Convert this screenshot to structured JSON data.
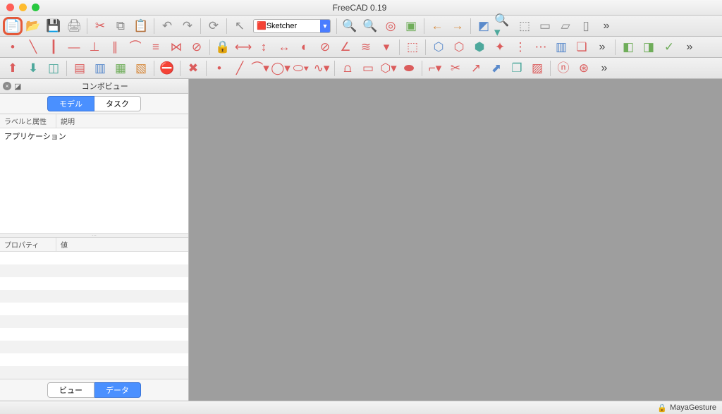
{
  "title": "FreeCAD 0.19",
  "workbench_selector": "Sketcher",
  "combo": {
    "panel_title": "コンボビュー",
    "tab_model": "モデル",
    "tab_task": "タスク",
    "col_label": "ラベルと属性",
    "col_desc": "説明",
    "tree_root": "アプリケーション",
    "prop_col1": "プロパティ",
    "prop_col2": "値",
    "bottom_view": "ビュー",
    "bottom_data": "データ"
  },
  "status": {
    "nav_style": "MayaGesture"
  },
  "toolbar1": [
    {
      "n": "new-file-icon",
      "g": "📄"
    },
    {
      "n": "open-file-icon",
      "g": "📂"
    },
    {
      "n": "save-icon",
      "g": "💾"
    },
    {
      "n": "print-icon",
      "g": "🖨"
    },
    {
      "n": "sep"
    },
    {
      "n": "cut-icon",
      "g": "✂",
      "c": "red"
    },
    {
      "n": "copy-icon",
      "g": "⧉"
    },
    {
      "n": "paste-icon",
      "g": "📋"
    },
    {
      "n": "sep"
    },
    {
      "n": "undo-icon",
      "g": "↶"
    },
    {
      "n": "redo-icon",
      "g": "↷"
    },
    {
      "n": "sep"
    },
    {
      "n": "refresh-icon",
      "g": "⟳"
    },
    {
      "n": "sep"
    },
    {
      "n": "pointer-icon",
      "g": "↖"
    },
    {
      "n": "workbench-select"
    },
    {
      "n": "sep"
    },
    {
      "n": "zoom-fit-icon",
      "g": "🔍",
      "c": "teal"
    },
    {
      "n": "zoom-select-icon",
      "g": "🔍"
    },
    {
      "n": "draw-style-icon",
      "g": "◎",
      "c": "red"
    },
    {
      "n": "bbox-icon",
      "g": "▣",
      "c": "green"
    },
    {
      "n": "sep"
    },
    {
      "n": "nav-back-icon",
      "g": "←",
      "c": "orange"
    },
    {
      "n": "nav-fwd-icon",
      "g": "→",
      "c": "orange"
    },
    {
      "n": "sep"
    },
    {
      "n": "iso-icon",
      "g": "◩",
      "c": "blue"
    },
    {
      "n": "zoom-dropdown-icon",
      "g": "🔍▾",
      "c": "teal"
    },
    {
      "n": "axo-icon",
      "g": "⬚"
    },
    {
      "n": "front-icon",
      "g": "▭"
    },
    {
      "n": "top-icon",
      "g": "▱"
    },
    {
      "n": "right-icon",
      "g": "▯"
    },
    {
      "n": "overflow",
      "g": "»"
    }
  ],
  "toolbar2": [
    {
      "n": "sketch-point-icon",
      "g": "•",
      "c": "red"
    },
    {
      "n": "sketch-line-icon",
      "g": "╲",
      "c": "red"
    },
    {
      "n": "sketch-hline-icon",
      "g": "┃",
      "c": "red"
    },
    {
      "n": "sketch-vline-icon",
      "g": "—",
      "c": "red"
    },
    {
      "n": "sketch-perpendicular-icon",
      "g": "⊥",
      "c": "red"
    },
    {
      "n": "sketch-parallel-icon",
      "g": "∥",
      "c": "red"
    },
    {
      "n": "sketch-tangent-icon",
      "g": "⌒",
      "c": "red"
    },
    {
      "n": "sketch-equal-icon",
      "g": "≡",
      "c": "red"
    },
    {
      "n": "sketch-symmetry-icon",
      "g": "⋈",
      "c": "red"
    },
    {
      "n": "sketch-block-icon",
      "g": "⊘",
      "c": "red"
    },
    {
      "n": "sep"
    },
    {
      "n": "lock-icon",
      "g": "🔒",
      "c": "red"
    },
    {
      "n": "dim-h-icon",
      "g": "⟷",
      "c": "red"
    },
    {
      "n": "dim-v-icon",
      "g": "↕",
      "c": "red"
    },
    {
      "n": "dim-len-icon",
      "g": "↔",
      "c": "red"
    },
    {
      "n": "dim-rad-icon",
      "g": "◐",
      "c": "red"
    },
    {
      "n": "dim-dia-icon",
      "g": "⊘",
      "c": "red"
    },
    {
      "n": "dim-ang-icon",
      "g": "∠",
      "c": "red"
    },
    {
      "n": "snell-icon",
      "g": "≋",
      "c": "red"
    },
    {
      "n": "internal-align-icon",
      "g": "▾",
      "c": "red"
    },
    {
      "n": "sep"
    },
    {
      "n": "toggle-ref-icon",
      "g": "⬚",
      "c": "red"
    },
    {
      "n": "sep"
    },
    {
      "n": "select-conflict-icon",
      "g": "⬡",
      "c": "blue"
    },
    {
      "n": "select-redundant-icon",
      "g": "⬡",
      "c": "red"
    },
    {
      "n": "select-elements-icon",
      "g": "⬢",
      "c": "teal"
    },
    {
      "n": "select-origin-icon",
      "g": "✦",
      "c": "red"
    },
    {
      "n": "sel-vert-icon",
      "g": "⋮",
      "c": "red"
    },
    {
      "n": "sel-horiz-icon",
      "g": "⋯",
      "c": "red"
    },
    {
      "n": "symmetry-op-icon",
      "g": "▥",
      "c": "blue"
    },
    {
      "n": "clone-icon",
      "g": "❏",
      "c": "red"
    },
    {
      "n": "overflow",
      "g": "»"
    },
    {
      "n": "sep"
    },
    {
      "n": "map-sketch-icon",
      "g": "◧",
      "c": "green"
    },
    {
      "n": "reorient-icon",
      "g": "◨",
      "c": "green"
    },
    {
      "n": "validate-icon",
      "g": "✓",
      "c": "green"
    },
    {
      "n": "overflow",
      "g": "»"
    }
  ],
  "toolbar3": [
    {
      "n": "leave-sketch-icon",
      "g": "⬆",
      "c": "red"
    },
    {
      "n": "view-sketch-icon",
      "g": "⬇",
      "c": "teal"
    },
    {
      "n": "section-icon",
      "g": "◫",
      "c": "teal"
    },
    {
      "n": "sep"
    },
    {
      "n": "create-sketch-icon",
      "g": "▤",
      "c": "red"
    },
    {
      "n": "edit-sketch-icon",
      "g": "▥",
      "c": "blue"
    },
    {
      "n": "merge-sketch-icon",
      "g": "▦",
      "c": "green"
    },
    {
      "n": "mirror-sketch-icon",
      "g": "▧",
      "c": "orange"
    },
    {
      "n": "sep"
    },
    {
      "n": "stop-icon",
      "g": "⛔",
      "c": "red"
    },
    {
      "n": "sep"
    },
    {
      "n": "close-icon",
      "g": "✖",
      "c": "red"
    },
    {
      "n": "sep"
    },
    {
      "n": "geo-point-icon",
      "g": "•",
      "c": "red"
    },
    {
      "n": "geo-line-icon",
      "g": "╱",
      "c": "red"
    },
    {
      "n": "geo-arc-icon",
      "g": "⌒▾",
      "c": "red"
    },
    {
      "n": "geo-circle-icon",
      "g": "◯▾",
      "c": "red"
    },
    {
      "n": "geo-ellipse-icon",
      "g": "⬭▾",
      "c": "red"
    },
    {
      "n": "geo-bspline-icon",
      "g": "∿▾",
      "c": "red"
    },
    {
      "n": "sep"
    },
    {
      "n": "polyline-icon",
      "g": "⩍",
      "c": "red"
    },
    {
      "n": "rect-icon",
      "g": "▭",
      "c": "red"
    },
    {
      "n": "polygon-icon",
      "g": "⬡▾",
      "c": "red"
    },
    {
      "n": "slot-icon",
      "g": "⬬",
      "c": "red"
    },
    {
      "n": "sep"
    },
    {
      "n": "fillet-icon",
      "g": "⌐▾",
      "c": "red"
    },
    {
      "n": "trim-icon",
      "g": "✂",
      "c": "red"
    },
    {
      "n": "extend-icon",
      "g": "↗",
      "c": "red"
    },
    {
      "n": "external-icon",
      "g": "⬈",
      "c": "blue"
    },
    {
      "n": "carbon-copy-icon",
      "g": "❐",
      "c": "teal"
    },
    {
      "n": "construction-icon",
      "g": "▨",
      "c": "red"
    },
    {
      "n": "sep"
    },
    {
      "n": "bspline-degree-icon",
      "g": "ⓝ",
      "c": "red"
    },
    {
      "n": "bspline-knot-icon",
      "g": "⊛",
      "c": "red"
    },
    {
      "n": "overflow",
      "g": "»"
    }
  ]
}
